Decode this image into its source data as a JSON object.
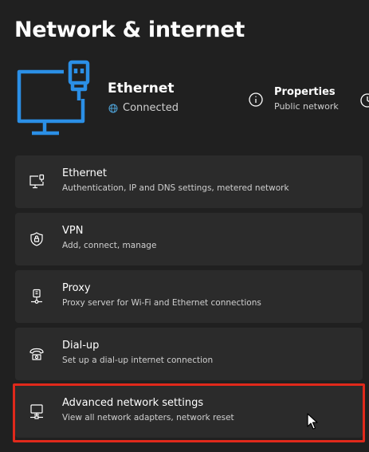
{
  "page": {
    "title": "Network & internet"
  },
  "hero": {
    "icon": "ethernet-monitor-icon",
    "name": "Ethernet",
    "status": "Connected",
    "status_icon": "globe-icon",
    "accent_color": "#2b8fe6",
    "status_color": "#4fa3d8"
  },
  "properties": {
    "icon": "info-icon",
    "title": "Properties",
    "subtitle": "Public network"
  },
  "items": [
    {
      "icon": "ethernet-icon",
      "title": "Ethernet",
      "subtitle": "Authentication, IP and DNS settings, metered network"
    },
    {
      "icon": "shield-icon",
      "title": "VPN",
      "subtitle": "Add, connect, manage"
    },
    {
      "icon": "proxy-icon",
      "title": "Proxy",
      "subtitle": "Proxy server for Wi-Fi and Ethernet connections"
    },
    {
      "icon": "dialup-icon",
      "title": "Dial-up",
      "subtitle": "Set up a dial-up internet connection"
    },
    {
      "icon": "network-settings-icon",
      "title": "Advanced network settings",
      "subtitle": "View all network adapters, network reset"
    }
  ],
  "highlight": {
    "target": "Advanced network settings",
    "color": "#e0291b"
  }
}
